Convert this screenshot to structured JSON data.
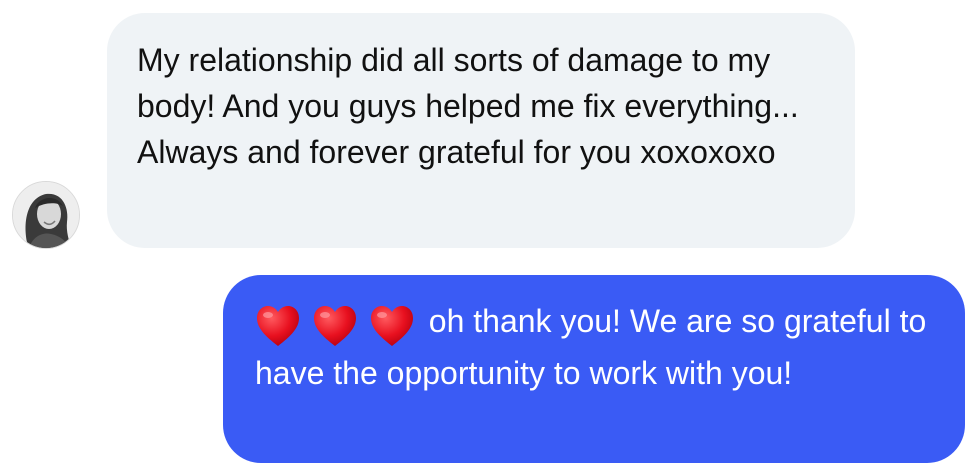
{
  "conversation": {
    "incoming": {
      "text": "My relationship did all sorts of damage to my body! And you guys helped me fix everything... Always and forever grateful for you xoxoxoxo"
    },
    "outgoing": {
      "emoji": [
        "heart-icon",
        "heart-icon",
        "heart-icon"
      ],
      "text": "oh thank you! We are so grateful to have the opportunity to work with you!"
    }
  },
  "colors": {
    "incoming_bubble": "#eff3f6",
    "outgoing_bubble": "#3a5bf5",
    "heart": "#e8101f"
  }
}
